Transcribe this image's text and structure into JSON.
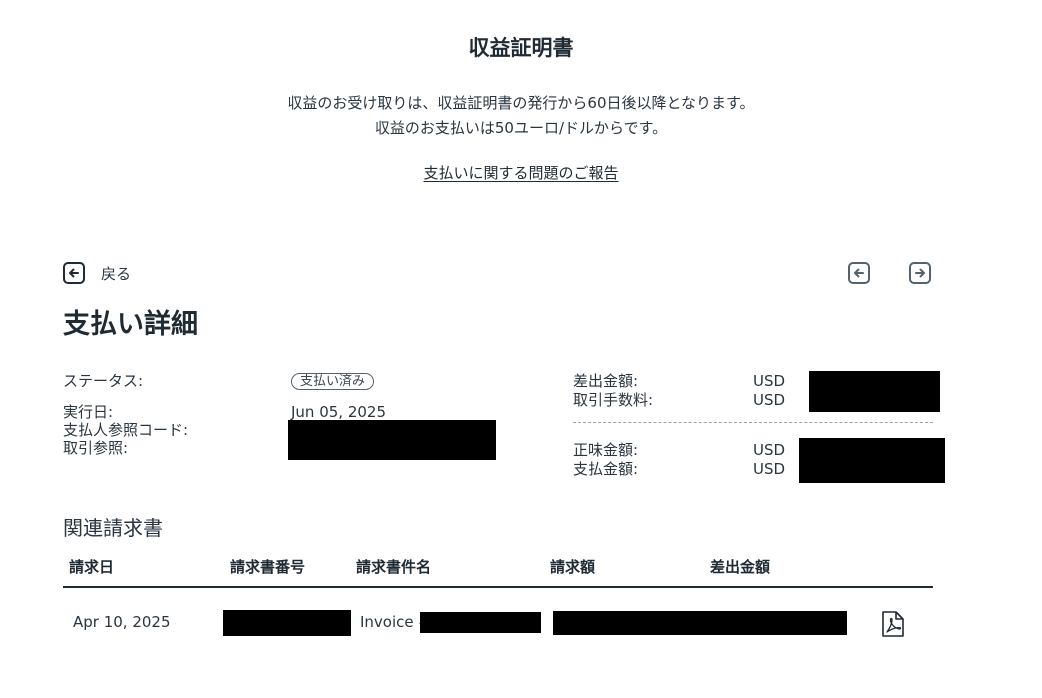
{
  "header": {
    "title": "収益証明書",
    "notice_line1": "収益のお受け取りは、収益証明書の発行から60日後以降となります。",
    "notice_line2": "収益のお支払いは50ユーロ/ドルからです。",
    "report_link": "支払いに関する問題のご報告"
  },
  "nav": {
    "back_label": "戻る",
    "back_icon": "arrow-left-square-icon",
    "prev_icon": "arrow-left-square-icon",
    "next_icon": "arrow-right-square-icon"
  },
  "details": {
    "title": "支払い詳細",
    "status_label": "ステータス:",
    "status_value": "支払い済み",
    "execution_date_label": "実行日:",
    "execution_date_value": "Jun 05, 2025",
    "payer_reference_label": "支払人参照コード:",
    "transaction_reference_label": "取引参照:",
    "amounts": {
      "sent_amount_label": "差出金額:",
      "sent_amount_currency": "USD",
      "fee_label": "取引手数料:",
      "fee_currency": "USD",
      "net_amount_label": "正味金額:",
      "net_amount_currency": "USD",
      "paid_amount_label": "支払金額:",
      "paid_amount_currency": "USD"
    }
  },
  "invoices": {
    "title": "関連請求書",
    "columns": [
      "請求日",
      "請求書番号",
      "請求書件名",
      "請求額",
      "差出金額"
    ],
    "rows": [
      {
        "date": "Apr 10, 2025",
        "subject_prefix": "Invoice #",
        "pdf_icon": "pdf-file-icon"
      }
    ]
  },
  "colors": {
    "text": "#1f2a33",
    "icon": "#55626e",
    "redaction": "#000000"
  }
}
